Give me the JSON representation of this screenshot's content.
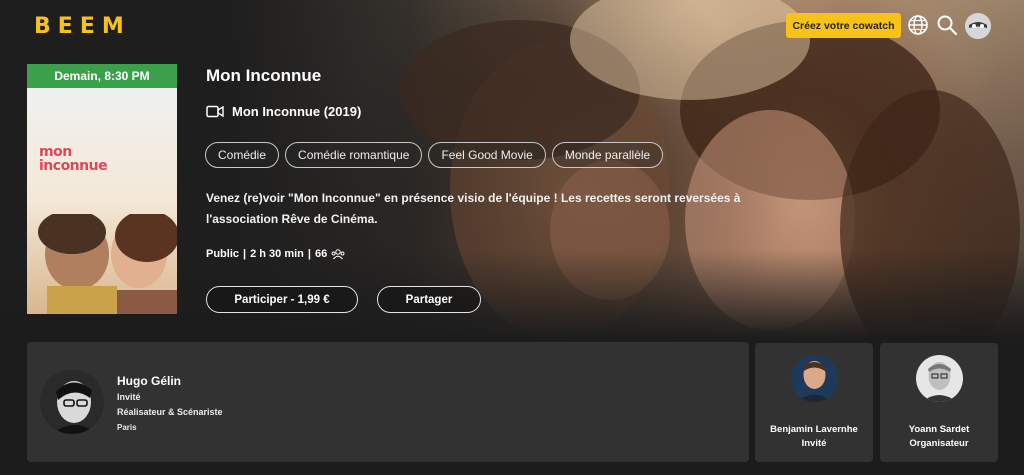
{
  "header": {
    "logo_letters": [
      "B",
      "E",
      "E",
      "M"
    ],
    "create_button": "Créez votre cowatch",
    "icons": [
      "globe-icon",
      "search-icon",
      "user-avatar-icon"
    ],
    "accent_color": "#f7c21a"
  },
  "poster": {
    "badge": "Demain, 8:30 PM",
    "title_line1": "mon",
    "title_line2": "inconnue",
    "badge_color": "#3aa04a"
  },
  "event": {
    "title": "Mon Inconnue",
    "film_label": "Mon Inconnue (2019)",
    "tags": [
      "Comédie",
      "Comédie romantique",
      "Feel Good Movie",
      "Monde parallèle"
    ],
    "description": "Venez (re)voir \"Mon Inconnue\" en présence visio de l'équipe ! Les recettes seront reversées à l'association Rêve de Cinéma.",
    "meta": {
      "visibility": "Public",
      "separator": "|",
      "duration": "2 h 30 min",
      "attendees": "66"
    },
    "participate_button": "Participer - 1,99 €",
    "share_button": "Partager"
  },
  "guests": {
    "main": {
      "name": "Hugo Gélin",
      "role": "Invité",
      "job": "Réalisateur & Scénariste",
      "city": "Paris"
    },
    "others": [
      {
        "name": "Benjamin Lavernhe",
        "role": "Invité"
      },
      {
        "name": "Yoann Sardet",
        "role": "Organisateur"
      }
    ]
  }
}
